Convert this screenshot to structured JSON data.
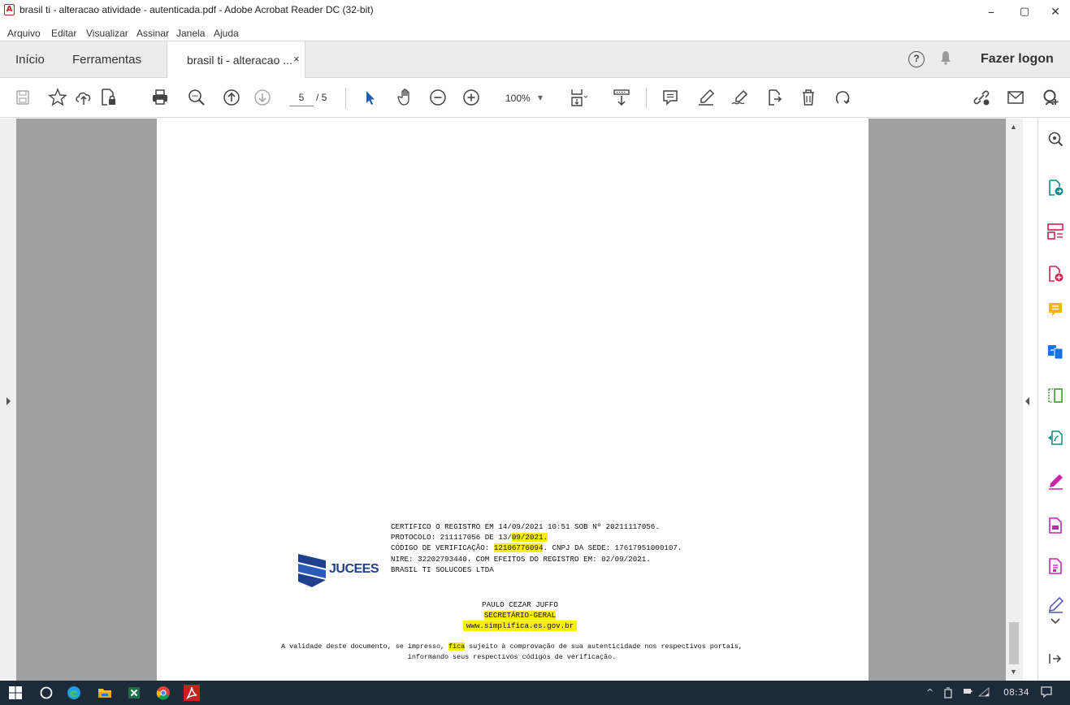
{
  "window": {
    "title": "brasil ti - alteracao atividade - autenticada.pdf - Adobe Acrobat Reader DC (32-bit)",
    "min": "–",
    "max": "▢",
    "close": "✕"
  },
  "menu": [
    "Arquivo",
    "Editar",
    "Visualizar",
    "Assinar",
    "Janela",
    "Ajuda"
  ],
  "tabs": {
    "home": "Início",
    "tools": "Ferramentas",
    "document": "brasil ti - alteracao ...",
    "close": "×"
  },
  "account": {
    "help": "?",
    "logon": "Fazer logon"
  },
  "toolbar": {
    "page_current": "5",
    "page_total": "/ 5",
    "zoom": "100%",
    "zoom_arrow": "▾"
  },
  "document": {
    "cert_line1": "CERTIFICO O REGISTRO EM 14/09/2021 10:51 SOB Nº 20211117056.",
    "cert_line2a": "PROTOCOLO: 211117056 DE 13/",
    "cert_line2b": "09/2021.",
    "cert_line3a": "CÓDIGO DE VERIFICAÇÃO: ",
    "cert_line3b": "12106776094",
    "cert_line3c": ". CNPJ DA SEDE: 17617951000107.",
    "cert_line4": "NIRE: 32202793440. COM EFEITOS DO REGISTRO EM: 02/09/2021.",
    "cert_line5": "BRASIL TI SOLUCOES LTDA",
    "signer_name": "PAULO CEZAR JUFFO",
    "signer_title": "SECRETÁRIO-GERAL",
    "website": "www.simplifica.es.gov.br",
    "validity_line1a": "A validade deste documento, se impresso, ",
    "validity_line1b": "fica",
    "validity_line1c": " sujeito à comprovação de sua autenticidade nos respectivos portais,",
    "validity_line2": "informando seus respectivos códigos de verificação.",
    "logo_text": "JUCEES"
  },
  "tray": {
    "time": "08:34",
    "up": "^"
  },
  "colors": {
    "highlight": "#f8f000",
    "acrobat_red": "#c4221f",
    "logo_blue": "#1f3f8f",
    "taskbar": "#1c2a3a"
  }
}
